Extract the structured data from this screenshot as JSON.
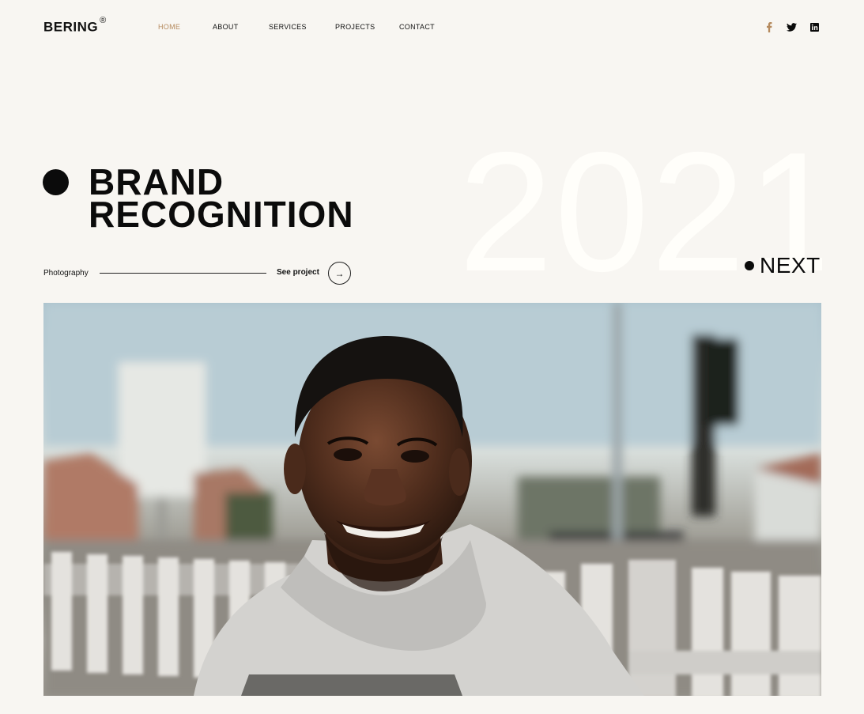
{
  "brand": {
    "name": "BERING",
    "mark": "®"
  },
  "nav": {
    "items": [
      {
        "label": "HOME",
        "active": true
      },
      {
        "label": "ABOUT",
        "active": false
      },
      {
        "label": "SERVICES",
        "active": false
      },
      {
        "label": "PROJECTS",
        "active": false
      },
      {
        "label": "CONTACT",
        "active": false
      }
    ],
    "accent_color": "#b58a5e"
  },
  "social": [
    "facebook-icon",
    "twitter-icon",
    "linkedin-icon"
  ],
  "hero": {
    "year": "2021",
    "title_line1": "BRAND",
    "title_line2": "RECOGNITION",
    "category": "Photography",
    "cta_label": "See project",
    "cta_icon": "→",
    "next_label": "NEXT"
  },
  "photo": {
    "subject": "smiling man in grey hoodie outdoors"
  },
  "colors": {
    "background": "#f8f6f2",
    "text": "#0b0b0b",
    "year": "#fffefa"
  }
}
